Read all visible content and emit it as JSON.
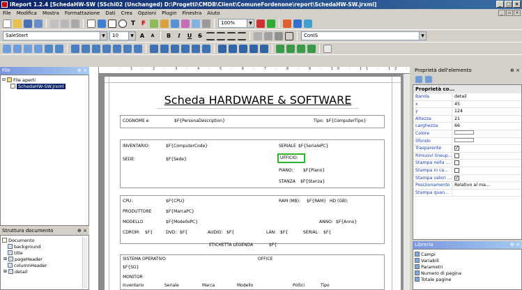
{
  "window": {
    "title": "iReport 1.2.4 [SchedaHW-SW (SSchi02 (Unchanged) D:\\Progetti\\CMDB\\Client\\ComuneFordenone\\report\\SchedaHW-SW.jrxml]"
  },
  "menu": [
    "File",
    "Modifica",
    "Mostra",
    "Formattazione",
    "Dati",
    "Crea",
    "Opzioni",
    "Plugin",
    "Finestra",
    "Aiuto"
  ],
  "toolbar": {
    "zoom": "100%",
    "band_select": "SaleStert",
    "font_size": "10",
    "font_name": "ConIS"
  },
  "files_panel": {
    "title": "File",
    "root": "File aperti",
    "item": "SchedaHW-SW.jrxml"
  },
  "structure_panel": {
    "title": "Struttura documento",
    "items": [
      "Documento",
      "background",
      "title",
      "pageHeader",
      "columnHeader",
      "detail"
    ]
  },
  "report": {
    "title": "Scheda HARDWARE & SOFTWARE",
    "cognome": "COGNOME e",
    "person_desc": "$F{PersonaDescription}",
    "tipo": "Tipo:",
    "tipo_val": "$F{ComputerTipo}",
    "inventario": "INVENTARIO:",
    "inventario_val": "$F{ComputerCode}",
    "seriale": "SERIALE",
    "seriale_val": "$F{SerialePC}",
    "sede": "SEDE:",
    "sede_val": "$F{Sede}",
    "ufficio": "UFFICIO:",
    "piano": "PIANO:",
    "piano_val": "$F{Piano}",
    "stanza": "STANZA",
    "stanza_val": "$F{Stanza}",
    "cpu": "CPU:",
    "cpu_val": "$F{CPU}",
    "ram": "RAM (MB):",
    "ram_val": "$F{RAM}",
    "hd": "HD (GB):",
    "produttore": "PRODUTTORE",
    "produttore_val": "$F{MarcaPC}",
    "modello": "MODELLO",
    "modello_val": "$F{ModelloPC}",
    "anno": "ANNO:",
    "anno_val": "$F{Anno}",
    "cdrom": "CDROM:",
    "cdrom_val": "$F{",
    "dvd": "DVD:",
    "dvd_val": "$F{",
    "audio": "AUDIO:",
    "audio_val": "$F{",
    "lan": "LAN:",
    "lan_val": "$F{",
    "serial": "SERIAL:",
    "serial_val": "$F{",
    "etichetta": "ETICHETTA LEGENDA",
    "etichetta_val": "$F{",
    "sistema": "SISTEMA OPERATIVO",
    "sistema_val": "$F{SO}",
    "office": "OFFICE",
    "monitor": "MONITOR",
    "bottom_cols": [
      "Inventario",
      "Seriale",
      "Marca",
      "Modello",
      "Pollici",
      "Tipo"
    ]
  },
  "properties_panel": {
    "title": "Proprietà dell'elemento",
    "section": "Proprietà co...",
    "rows": [
      {
        "name": "Banda",
        "value": "detail"
      },
      {
        "name": "x",
        "value": "45"
      },
      {
        "name": "y",
        "value": "124"
      },
      {
        "name": "Altezza",
        "value": "21"
      },
      {
        "name": "Larghezza",
        "value": "66"
      },
      {
        "name": "Colore",
        "value": ""
      },
      {
        "name": "Sfondo",
        "value": ""
      },
      {
        "name": "Trasparente",
        "value": ""
      },
      {
        "name": "Rimuovi lineup...",
        "value": ""
      },
      {
        "name": "Stampa nella ...",
        "value": ""
      },
      {
        "name": "Stampa in ca...",
        "value": ""
      },
      {
        "name": "Stampa valori ...",
        "value": ""
      },
      {
        "name": "Posizionamento",
        "value": "Relativo al ma..."
      },
      {
        "name": "Stampa quan...",
        "value": ""
      }
    ]
  },
  "library_panel": {
    "title": "Libreria",
    "items": [
      "Campi",
      "Variabili",
      "Parametri",
      "Numero di pagina",
      "Totale pagine"
    ]
  },
  "colors": {
    "accent": "#0a246a",
    "selection": "#2bb52b"
  }
}
